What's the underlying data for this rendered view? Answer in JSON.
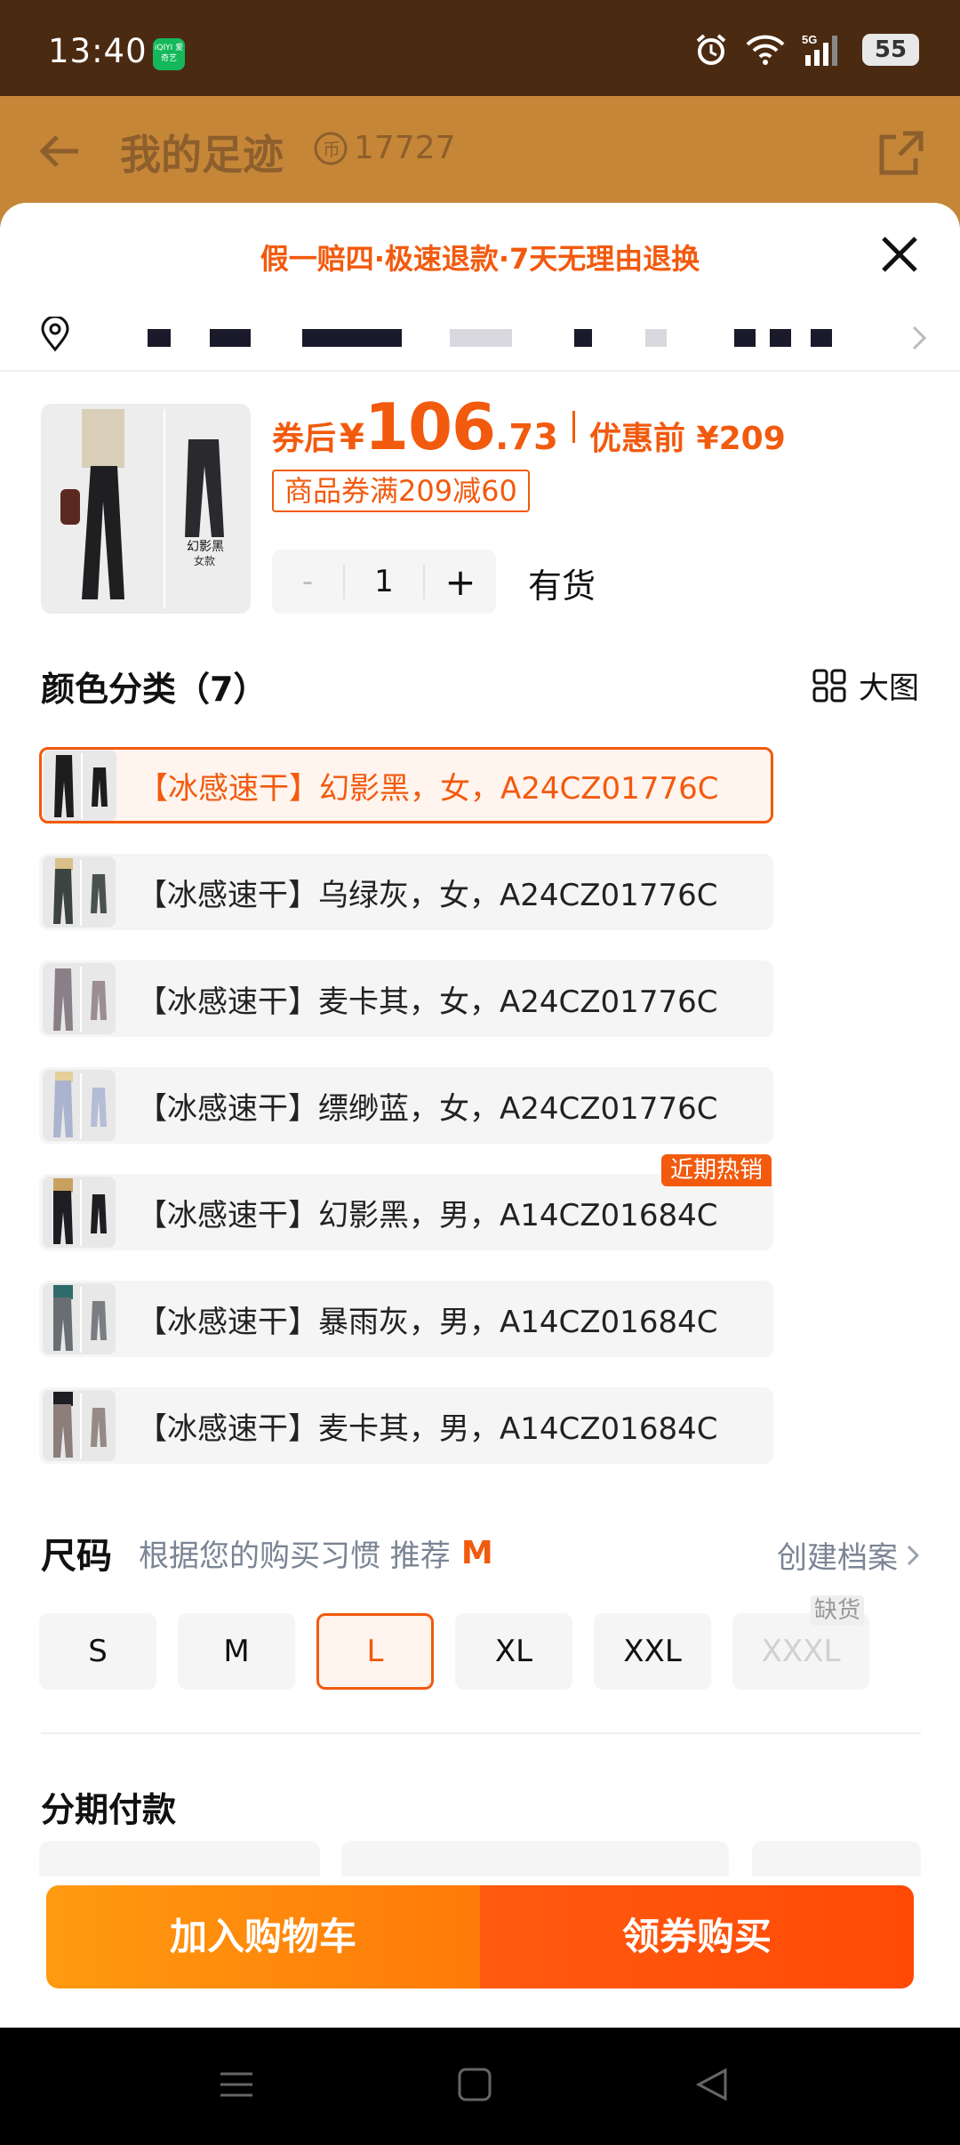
{
  "status_bar": {
    "time": "13:40",
    "app_badge": "iQIYI 爱奇艺",
    "network": "5G",
    "battery": "55"
  },
  "background_header": {
    "title": "我的足迹",
    "coin_count": "17727"
  },
  "sheet": {
    "promo_banner": "假一赔四·极速退款·7天无理由退换",
    "product": {
      "thumb_label": "幻影黑",
      "thumb_sublabel": "女款",
      "price_after_label": "券后",
      "currency": "¥",
      "price_integer": "106",
      "price_decimal": ".73",
      "price_before_label": "优惠前 ¥209",
      "coupon": "商品券满209减60",
      "quantity": "1",
      "minus": "-",
      "plus": "+",
      "stock_status": "有货"
    },
    "color_section": {
      "title": "颜色分类（7）",
      "view_toggle": "大图"
    },
    "color_options": [
      {
        "label": "【冰感速干】幻影黑，女，A24CZ01776C",
        "selected": true
      },
      {
        "label": "【冰感速干】乌绿灰，女，A24CZ01776C"
      },
      {
        "label": "【冰感速干】麦卡其，女，A24CZ01776C"
      },
      {
        "label": "【冰感速干】缥缈蓝，女，A24CZ01776C"
      },
      {
        "label": "【冰感速干】幻影黑，男，A14CZ01684C",
        "badge": "近期热销"
      },
      {
        "label": "【冰感速干】暴雨灰，男，A14CZ01684C"
      },
      {
        "label": "【冰感速干】麦卡其，男，A14CZ01684C"
      }
    ],
    "size_section": {
      "title": "尺码",
      "recommend_text": "根据您的购买习惯 推荐",
      "recommend_value": "M",
      "profile_link": "创建档案",
      "sizes": [
        {
          "label": "S"
        },
        {
          "label": "M"
        },
        {
          "label": "L",
          "selected": true
        },
        {
          "label": "XL"
        },
        {
          "label": "XXL"
        },
        {
          "label": "XXXL",
          "badge": "缺货",
          "disabled": true
        }
      ]
    },
    "installment_title": "分期付款",
    "buttons": {
      "add_to_cart": "加入购物车",
      "buy_with_coupon": "领券购买"
    }
  },
  "colors": {
    "accent": "#f25a0e",
    "cart_button": "#ff8a0c",
    "buy_button": "#ff520a",
    "status_bar": "#4b2a12"
  }
}
